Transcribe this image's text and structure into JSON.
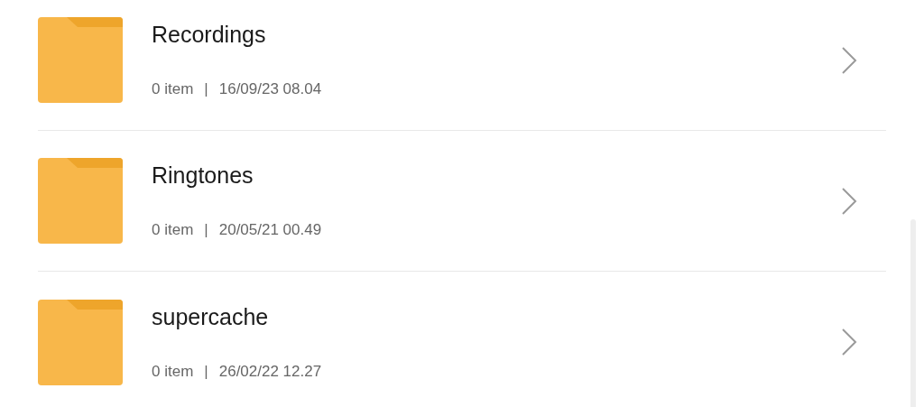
{
  "folders": [
    {
      "name": "Recordings",
      "count": "0 item",
      "separator": "|",
      "modified": "16/09/23 08.04"
    },
    {
      "name": "Ringtones",
      "count": "0 item",
      "separator": "|",
      "modified": "20/05/21 00.49"
    },
    {
      "name": "supercache",
      "count": "0 item",
      "separator": "|",
      "modified": "26/02/22 12.27"
    }
  ]
}
